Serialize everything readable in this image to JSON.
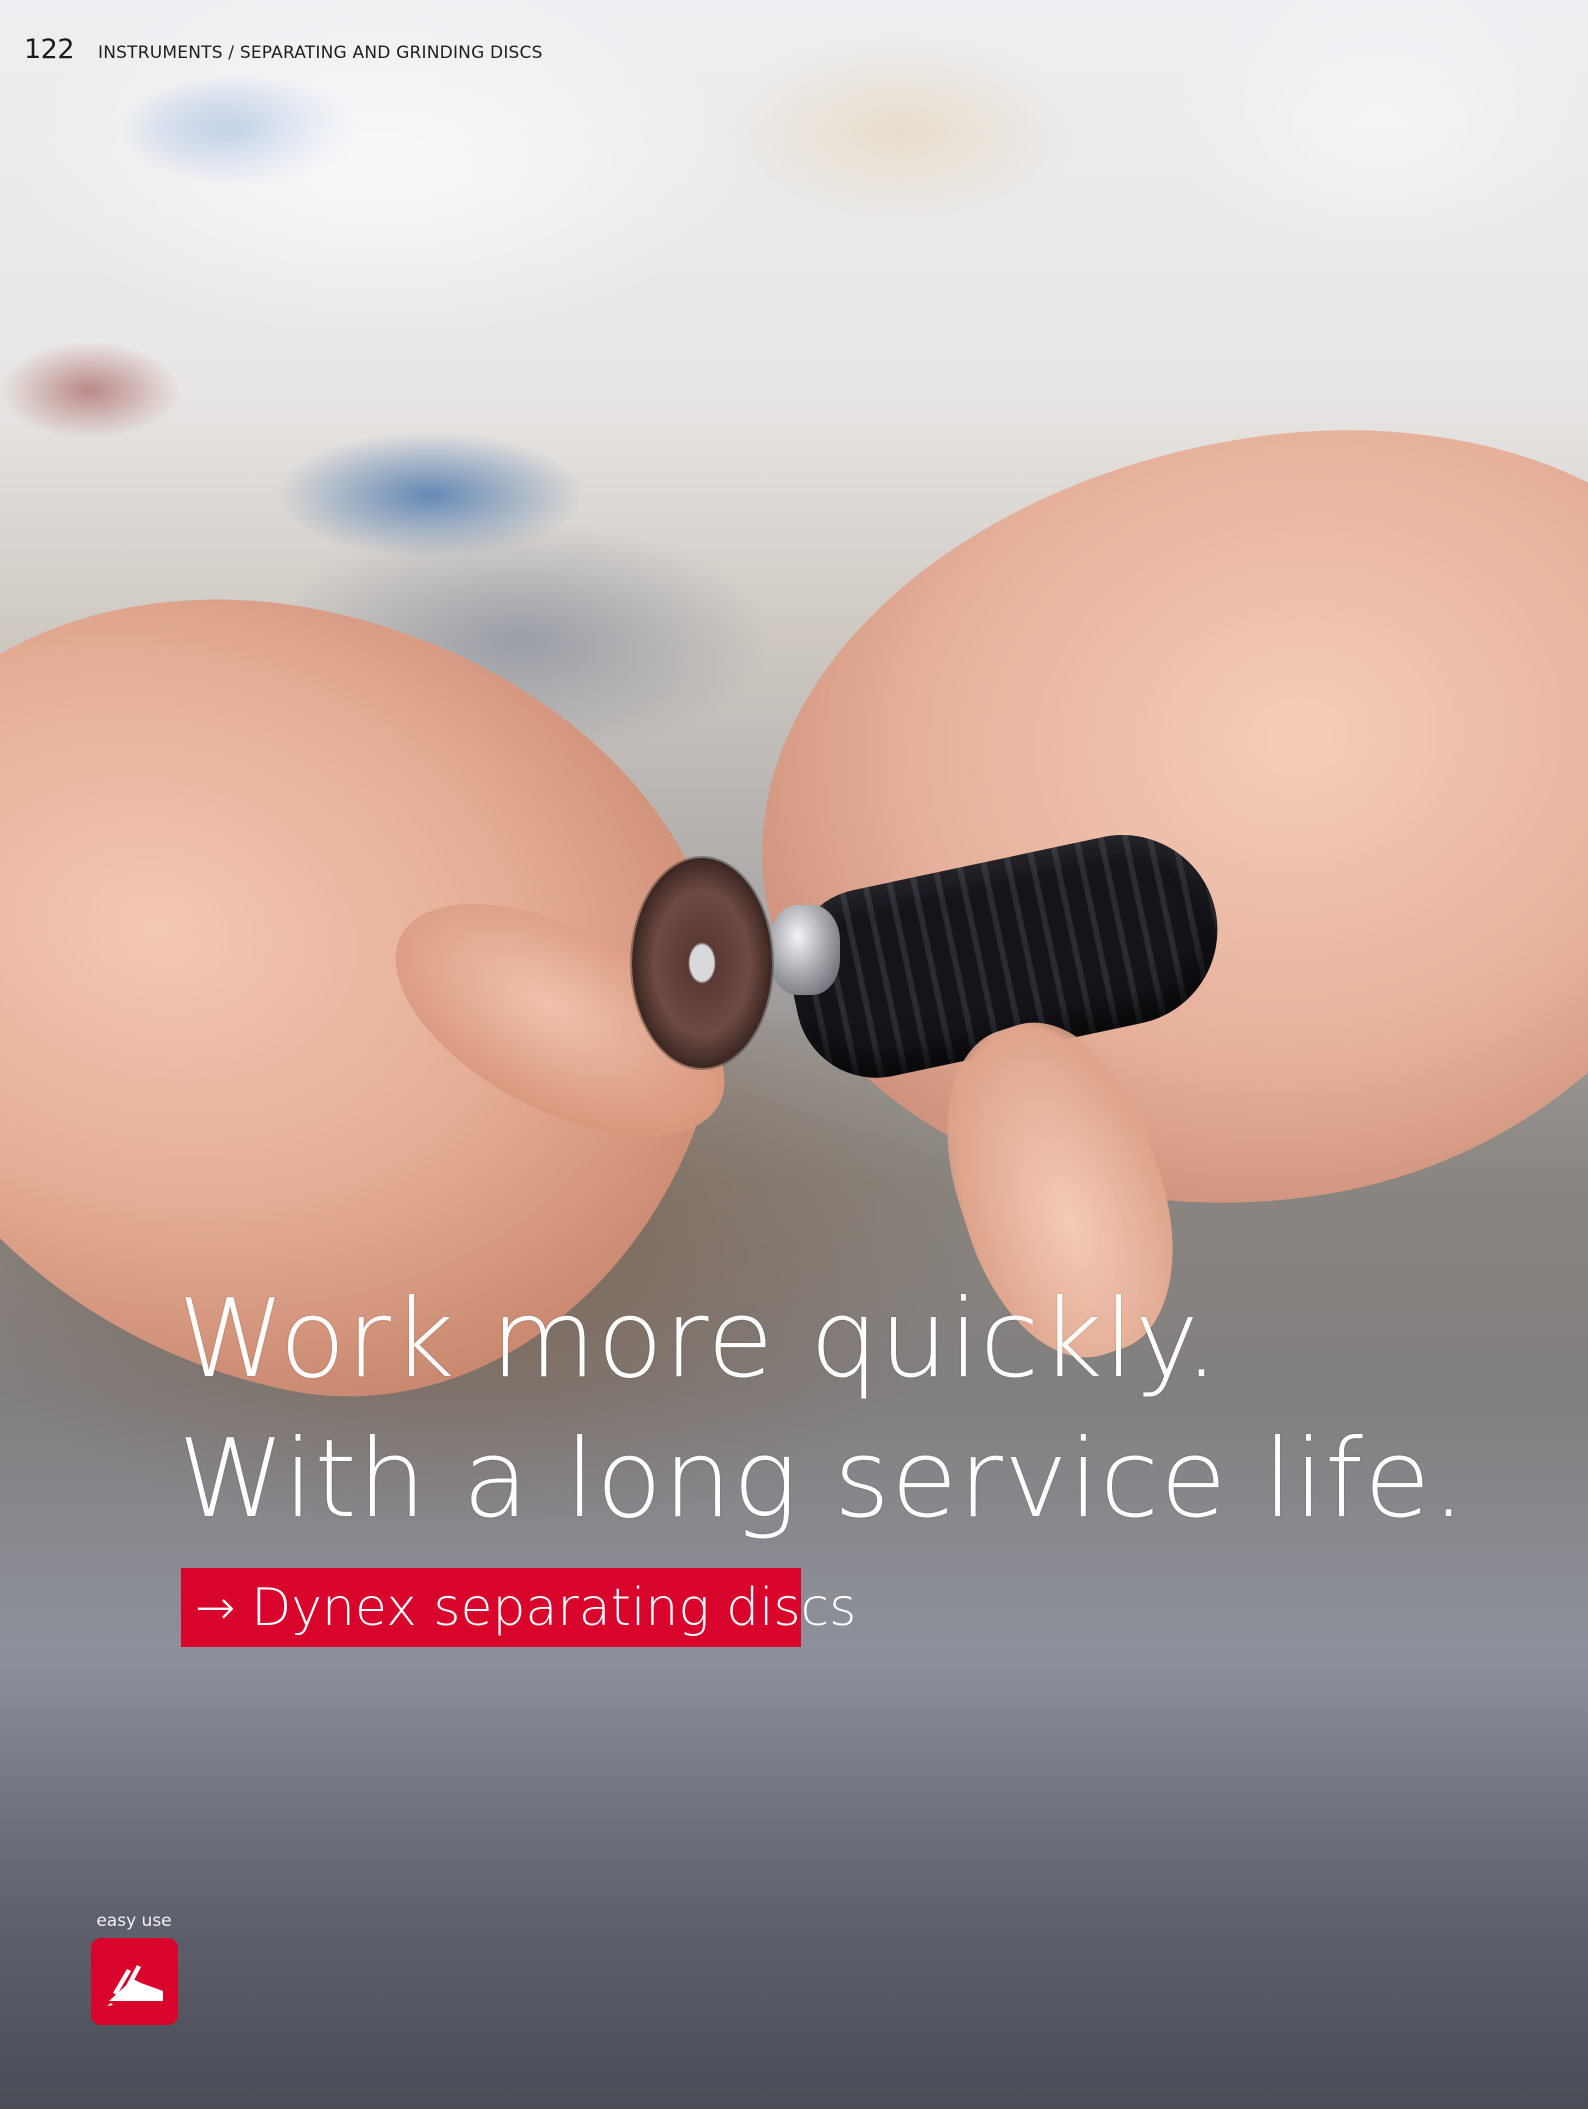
{
  "header": {
    "page_number": "122",
    "section": "INSTRUMENTS / SEPARATING AND GRINDING DISCS"
  },
  "headline": {
    "line1": "Work more quickly.",
    "line2": "With a long service life."
  },
  "product_tag": {
    "arrow": "→",
    "label": "Dynex separating discs"
  },
  "badge": {
    "label": "easy use",
    "icon": "hand-with-instrument-icon"
  },
  "colors": {
    "accent_red": "#d9042b",
    "headline_text": "#ffffff"
  }
}
